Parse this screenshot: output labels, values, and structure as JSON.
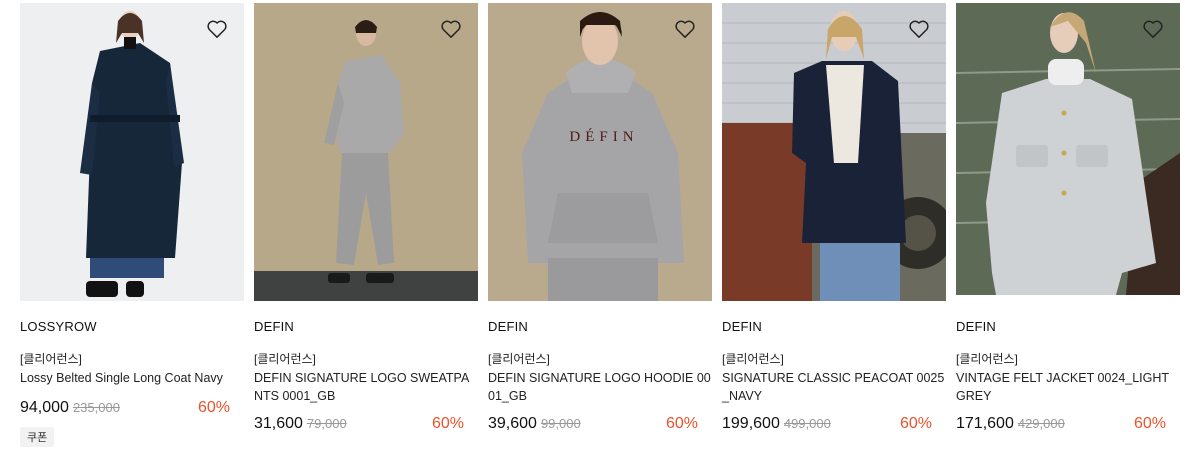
{
  "products": [
    {
      "brand": "LOSSYROW",
      "tag": "[클리어런스]",
      "title": "Lossy Belted Single Long Coat Navy",
      "price": "94,000",
      "original_price": "235,000",
      "discount": "60%",
      "coupon": "쿠폰",
      "wishlist_icon": "heart-outline-icon"
    },
    {
      "brand": "DEFIN",
      "tag": "[클리어런스]",
      "title": "DEFIN SIGNATURE LOGO SWEATPANTS 0001_GB",
      "price": "31,600",
      "original_price": "79,000",
      "discount": "60%",
      "wishlist_icon": "heart-outline-icon"
    },
    {
      "brand": "DEFIN",
      "tag": "[클리어런스]",
      "title": "DEFIN SIGNATURE LOGO HOODIE 0001_GB",
      "price": "39,600",
      "original_price": "99,000",
      "discount": "60%",
      "image_text": "DÉFIN",
      "wishlist_icon": "heart-outline-icon"
    },
    {
      "brand": "DEFIN",
      "tag": "[클리어런스]",
      "title": "SIGNATURE CLASSIC PEACOAT 0025_NAVY",
      "price": "199,600",
      "original_price": "499,000",
      "discount": "60%",
      "wishlist_icon": "heart-outline-icon"
    },
    {
      "brand": "DEFIN",
      "tag": "[클리어런스]",
      "title": "VINTAGE FELT JACKET 0024_LIGHT GREY",
      "price": "171,600",
      "original_price": "429,000",
      "discount": "60%",
      "wishlist_icon": "heart-outline-icon"
    }
  ],
  "colors": {
    "discount": "#e8532b",
    "original_price": "#999999"
  }
}
